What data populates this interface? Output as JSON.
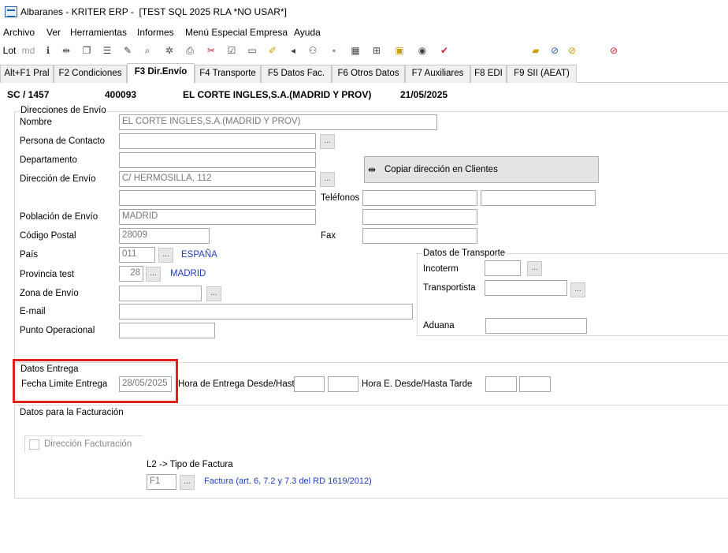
{
  "window": {
    "title": "Albaranes - KRITER ERP -  [TEST SQL 2025 RLA *NO USAR*]"
  },
  "menu": [
    "Archivo",
    "Ver",
    "Herramientas",
    "Informes",
    "Menú Especial Empresa",
    "Ayuda"
  ],
  "toolbar": {
    "first_label": "Lot",
    "second_label": "md"
  },
  "tabs": [
    "Alt+F1 Pral",
    "F2 Condiciones",
    "F3 Dir.Envío",
    "F4 Transporte",
    "F5 Datos Fac.",
    "F6 Otros Datos",
    "F7 Auxiliares",
    "F8 EDI",
    "F9 SII (AEAT)"
  ],
  "header": {
    "doc": "SC / 1457",
    "code": "400093",
    "client": "EL CORTE INGLES,S.A.(MADRID Y PROV)",
    "date": "21/05/2025"
  },
  "shipping": {
    "section_title": "Direcciones de Envío",
    "nombre_label": "Nombre",
    "nombre_value": "EL CORTE INGLES,S.A.(MADRID Y PROV)",
    "contacto_label": "Persona de Contacto",
    "departamento_label": "Departamento",
    "direccion_label": "Dirección de Envío",
    "direccion_value": "C/ HERMOSILLA, 112",
    "telefonos_label": "Teléfonos",
    "poblacion_label": "Población de Envío",
    "poblacion_value": "MADRID",
    "cp_label": "Código Postal",
    "cp_value": "28009",
    "fax_label": "Fax",
    "pais_label": "País",
    "pais_code": "011",
    "pais_name": "ESPAÑA",
    "provincia_label": "Provincia test",
    "provincia_code": "28",
    "provincia_name": "MADRID",
    "zona_label": "Zona de Envío",
    "email_label": "E-mail",
    "punto_label": "Punto Operacional",
    "copy_button": "Copiar dirección en Clientes"
  },
  "transport": {
    "section_title": "Datos de Transporte",
    "incoterm_label": "Incoterm",
    "transportista_label": "Transportista",
    "aduana_label": "Aduana"
  },
  "delivery": {
    "section_title": "Datos Entrega",
    "fecha_label": "Fecha Limite Entrega",
    "fecha_value": "28/05/2025",
    "hora_label": "Hora de Entrega Desde/Hasta",
    "hora_tarde_label": "Hora E. Desde/Hasta Tarde"
  },
  "billing": {
    "section_title": "Datos para la Facturación",
    "direccion_check_label": "Dirección Facturación",
    "tipo_label": "L2 -> Tipo de Factura",
    "tipo_value": "F1",
    "tipo_desc": "Factura (art. 6, 7.2 y 7.3 del RD 1619/2012)"
  },
  "colors": {
    "highlight": "#e0201a",
    "link_blue": "#1f3fbf"
  }
}
